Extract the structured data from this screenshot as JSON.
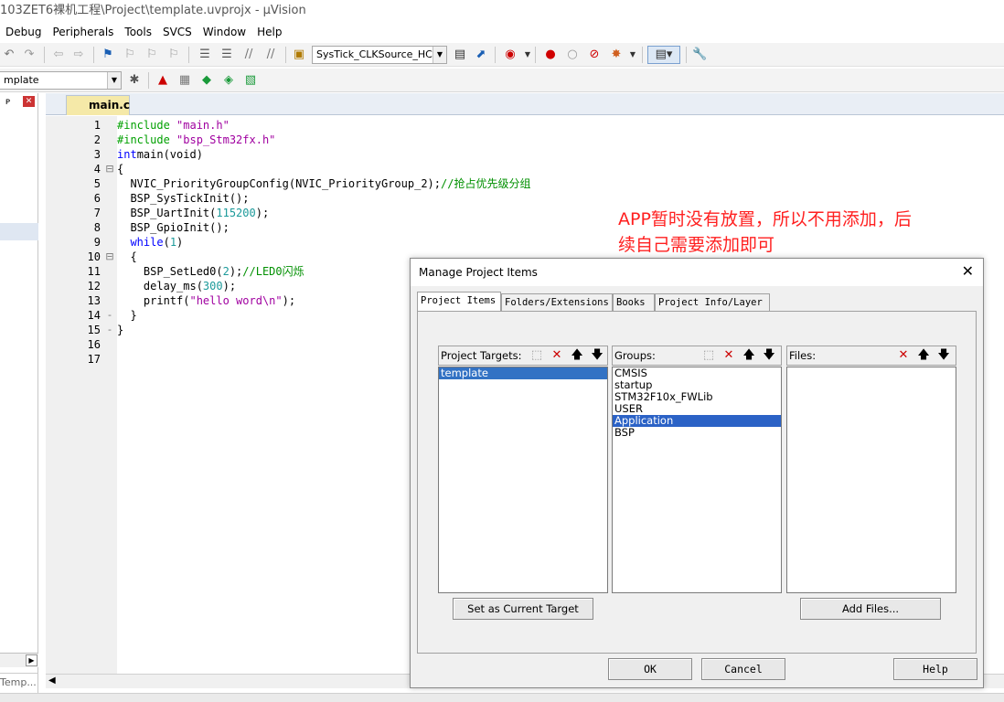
{
  "window": {
    "title": "103ZET6裸机工程\\Project\\template.uvprojx - µVision"
  },
  "menu": [
    "Debug",
    "Peripherals",
    "Tools",
    "SVCS",
    "Window",
    "Help"
  ],
  "toolbar": {
    "systick_combo": "SysTick_CLKSource_HCLK",
    "target_combo": "mplate"
  },
  "left_panel": {
    "pin": "ᴘ",
    "close": "✕",
    "bottom_tab": "Temp..."
  },
  "editor": {
    "tab_label": "main.c",
    "lines": [
      {
        "n": "1",
        "fold": "",
        "parts": [
          [
            "pre",
            "#include "
          ],
          [
            "str",
            "\"main.h\""
          ]
        ]
      },
      {
        "n": "2",
        "fold": "",
        "parts": [
          [
            "pre",
            "#include "
          ],
          [
            "str",
            "\"bsp_Stm32fx.h\""
          ]
        ]
      },
      {
        "n": "3",
        "fold": "",
        "parts": [
          [
            "kw",
            "int"
          ],
          [
            "",
            "main(void)"
          ]
        ]
      },
      {
        "n": "4",
        "fold": "⊟",
        "parts": [
          [
            "",
            "{"
          ]
        ]
      },
      {
        "n": "5",
        "fold": "",
        "parts": [
          [
            "",
            "  NVIC_PriorityGroupConfig(NVIC_PriorityGroup_2);"
          ],
          [
            "cmt",
            "//抢占优先级分组"
          ]
        ]
      },
      {
        "n": "6",
        "fold": "",
        "parts": [
          [
            "",
            "  BSP_SysTickInit();"
          ]
        ]
      },
      {
        "n": "7",
        "fold": "",
        "parts": [
          [
            "",
            "  BSP_UartInit("
          ],
          [
            "num",
            "115200"
          ],
          [
            "",
            ");"
          ]
        ]
      },
      {
        "n": "8",
        "fold": "",
        "parts": [
          [
            "",
            "  BSP_GpioInit();"
          ]
        ]
      },
      {
        "n": "9",
        "fold": "",
        "parts": [
          [
            "kw",
            "  while"
          ],
          [
            "",
            "("
          ],
          [
            "num",
            "1"
          ],
          [
            "",
            ")"
          ]
        ]
      },
      {
        "n": "10",
        "fold": "⊟",
        "parts": [
          [
            "",
            "  {"
          ]
        ]
      },
      {
        "n": "11",
        "fold": "",
        "parts": [
          [
            "",
            "    BSP_SetLed0("
          ],
          [
            "num",
            "2"
          ],
          [
            "",
            ");"
          ],
          [
            "cmt",
            "//LED0闪烁"
          ]
        ]
      },
      {
        "n": "12",
        "fold": "",
        "parts": [
          [
            "",
            "    delay_ms("
          ],
          [
            "num",
            "300"
          ],
          [
            "",
            ");"
          ]
        ]
      },
      {
        "n": "13",
        "fold": "",
        "parts": [
          [
            "",
            "    printf("
          ],
          [
            "str",
            "\"hello word\\n\""
          ],
          [
            "",
            ");"
          ]
        ]
      },
      {
        "n": "14",
        "fold": "-",
        "parts": [
          [
            "",
            "  }"
          ]
        ]
      },
      {
        "n": "15",
        "fold": "-",
        "parts": [
          [
            "",
            "}"
          ]
        ]
      },
      {
        "n": "16",
        "fold": "",
        "parts": [
          [
            "",
            ""
          ]
        ]
      },
      {
        "n": "17",
        "fold": "",
        "parts": [
          [
            "",
            ""
          ]
        ]
      }
    ]
  },
  "annotation": {
    "line1": "APP暂时没有放置，所以不用添加，后",
    "line2": "续自己需要添加即可"
  },
  "dialog": {
    "title": "Manage Project Items",
    "tabs": [
      "Project Items",
      "Folders/Extensions",
      "Books",
      "Project Info/Layer"
    ],
    "targets_label": "Project Targets:",
    "groups_label": "Groups:",
    "files_label": "Files:",
    "targets": [
      "template"
    ],
    "groups": [
      "CMSIS",
      "startup",
      "STM32F10x_FWLib",
      "USER",
      "Application",
      "BSP"
    ],
    "selected_group": "Application",
    "set_target_button": "Set as Current Target",
    "add_files_button": "Add Files...",
    "ok_button": "OK",
    "cancel_button": "Cancel",
    "help_button": "Help"
  }
}
